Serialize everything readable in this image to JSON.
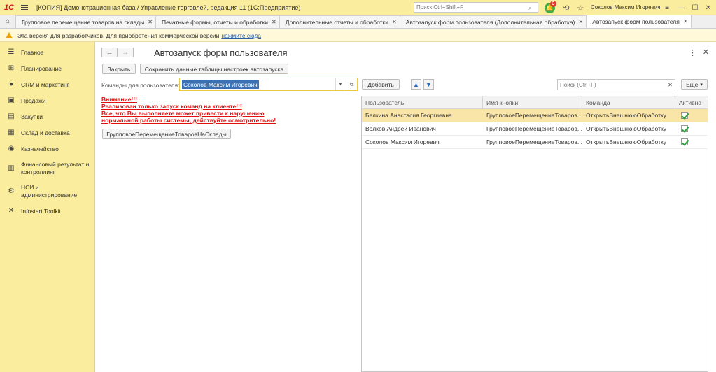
{
  "titlebar": {
    "logo": "1С",
    "app_title": "[КОПИЯ] Демонстрационная база / Управление торговлей, редакция 11  (1С:Предприятие)",
    "search_placeholder": "Поиск Ctrl+Shift+F",
    "notifications_count": "3",
    "user_name": "Соколов Максим Игоревич"
  },
  "tabs": [
    {
      "label": "Групповое перемещение товаров на склады"
    },
    {
      "label": "Печатные формы, отчеты и обработки"
    },
    {
      "label": "Дополнительные отчеты и обработки"
    },
    {
      "label": "Автозапуск форм пользователя (Дополнительная обработка)"
    },
    {
      "label": "Автозапуск форм пользователя"
    }
  ],
  "warning": {
    "text": "Эта версия для разработчиков. Для приобретения коммерческой версии",
    "link": "нажмите сюда"
  },
  "sidebar": {
    "items": [
      {
        "label": "Главное",
        "icon": "menu-icon"
      },
      {
        "label": "Планирование",
        "icon": "planning-icon"
      },
      {
        "label": "CRM и маркетинг",
        "icon": "crm-icon"
      },
      {
        "label": "Продажи",
        "icon": "sales-icon"
      },
      {
        "label": "Закупки",
        "icon": "cart-icon"
      },
      {
        "label": "Склад и доставка",
        "icon": "warehouse-icon"
      },
      {
        "label": "Казначейство",
        "icon": "treasury-icon"
      },
      {
        "label": "Финансовый результат и контроллинг",
        "icon": "chart-icon"
      },
      {
        "label": "НСИ и администрирование",
        "icon": "gear-icon"
      },
      {
        "label": "Infostart Toolkit",
        "icon": "tools-icon"
      }
    ]
  },
  "form": {
    "title": "Автозапуск форм пользователя",
    "close_button": "Закрыть",
    "save_button": "Сохранить данные таблицы настроек автозапуска",
    "commands_label": "Команды для пользователя:",
    "commands_value": "Соколов Максим Игоревич",
    "warning_lines": [
      "Внимание!!!",
      "Реализован только запуск команд на клиенте!!!",
      "Все, что Вы выполняете может привести к нарушению",
      "нормальной работы системы, действуйте осмотрительно!"
    ],
    "command_button": "ГрупповоеПеремещениеТоваровНаСклады",
    "add_button": "Добавить",
    "search_placeholder": "Поиск (Ctrl+F)",
    "more_button": "Еще"
  },
  "table": {
    "columns": [
      "Пользователь",
      "Имя кнопки",
      "Команда",
      "Активна"
    ],
    "rows": [
      {
        "user": "Белкина Анастасия Георгиевна",
        "button": "ГрупповоеПеремещениеТоваров...",
        "command": "ОткрытьВнешнююОбработку",
        "active": true,
        "selected": true
      },
      {
        "user": "Волков Андрей Иванович",
        "button": "ГрупповоеПеремещениеТоваров...",
        "command": "ОткрытьВнешнююОбработку",
        "active": true,
        "selected": false
      },
      {
        "user": "Соколов Максим Игоревич",
        "button": "ГрупповоеПеремещениеТоваров...",
        "command": "ОткрытьВнешнююОбработку",
        "active": true,
        "selected": false
      }
    ]
  }
}
